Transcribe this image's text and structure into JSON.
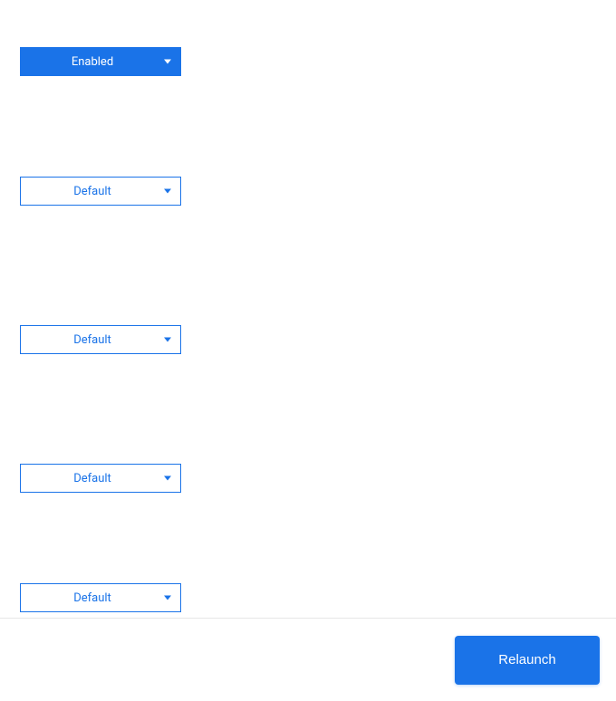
{
  "dropdowns": [
    {
      "value": "Enabled"
    },
    {
      "value": "Default"
    },
    {
      "value": "Default"
    },
    {
      "value": "Default"
    },
    {
      "value": "Default"
    }
  ],
  "footer": {
    "relaunch_label": "Relaunch"
  }
}
